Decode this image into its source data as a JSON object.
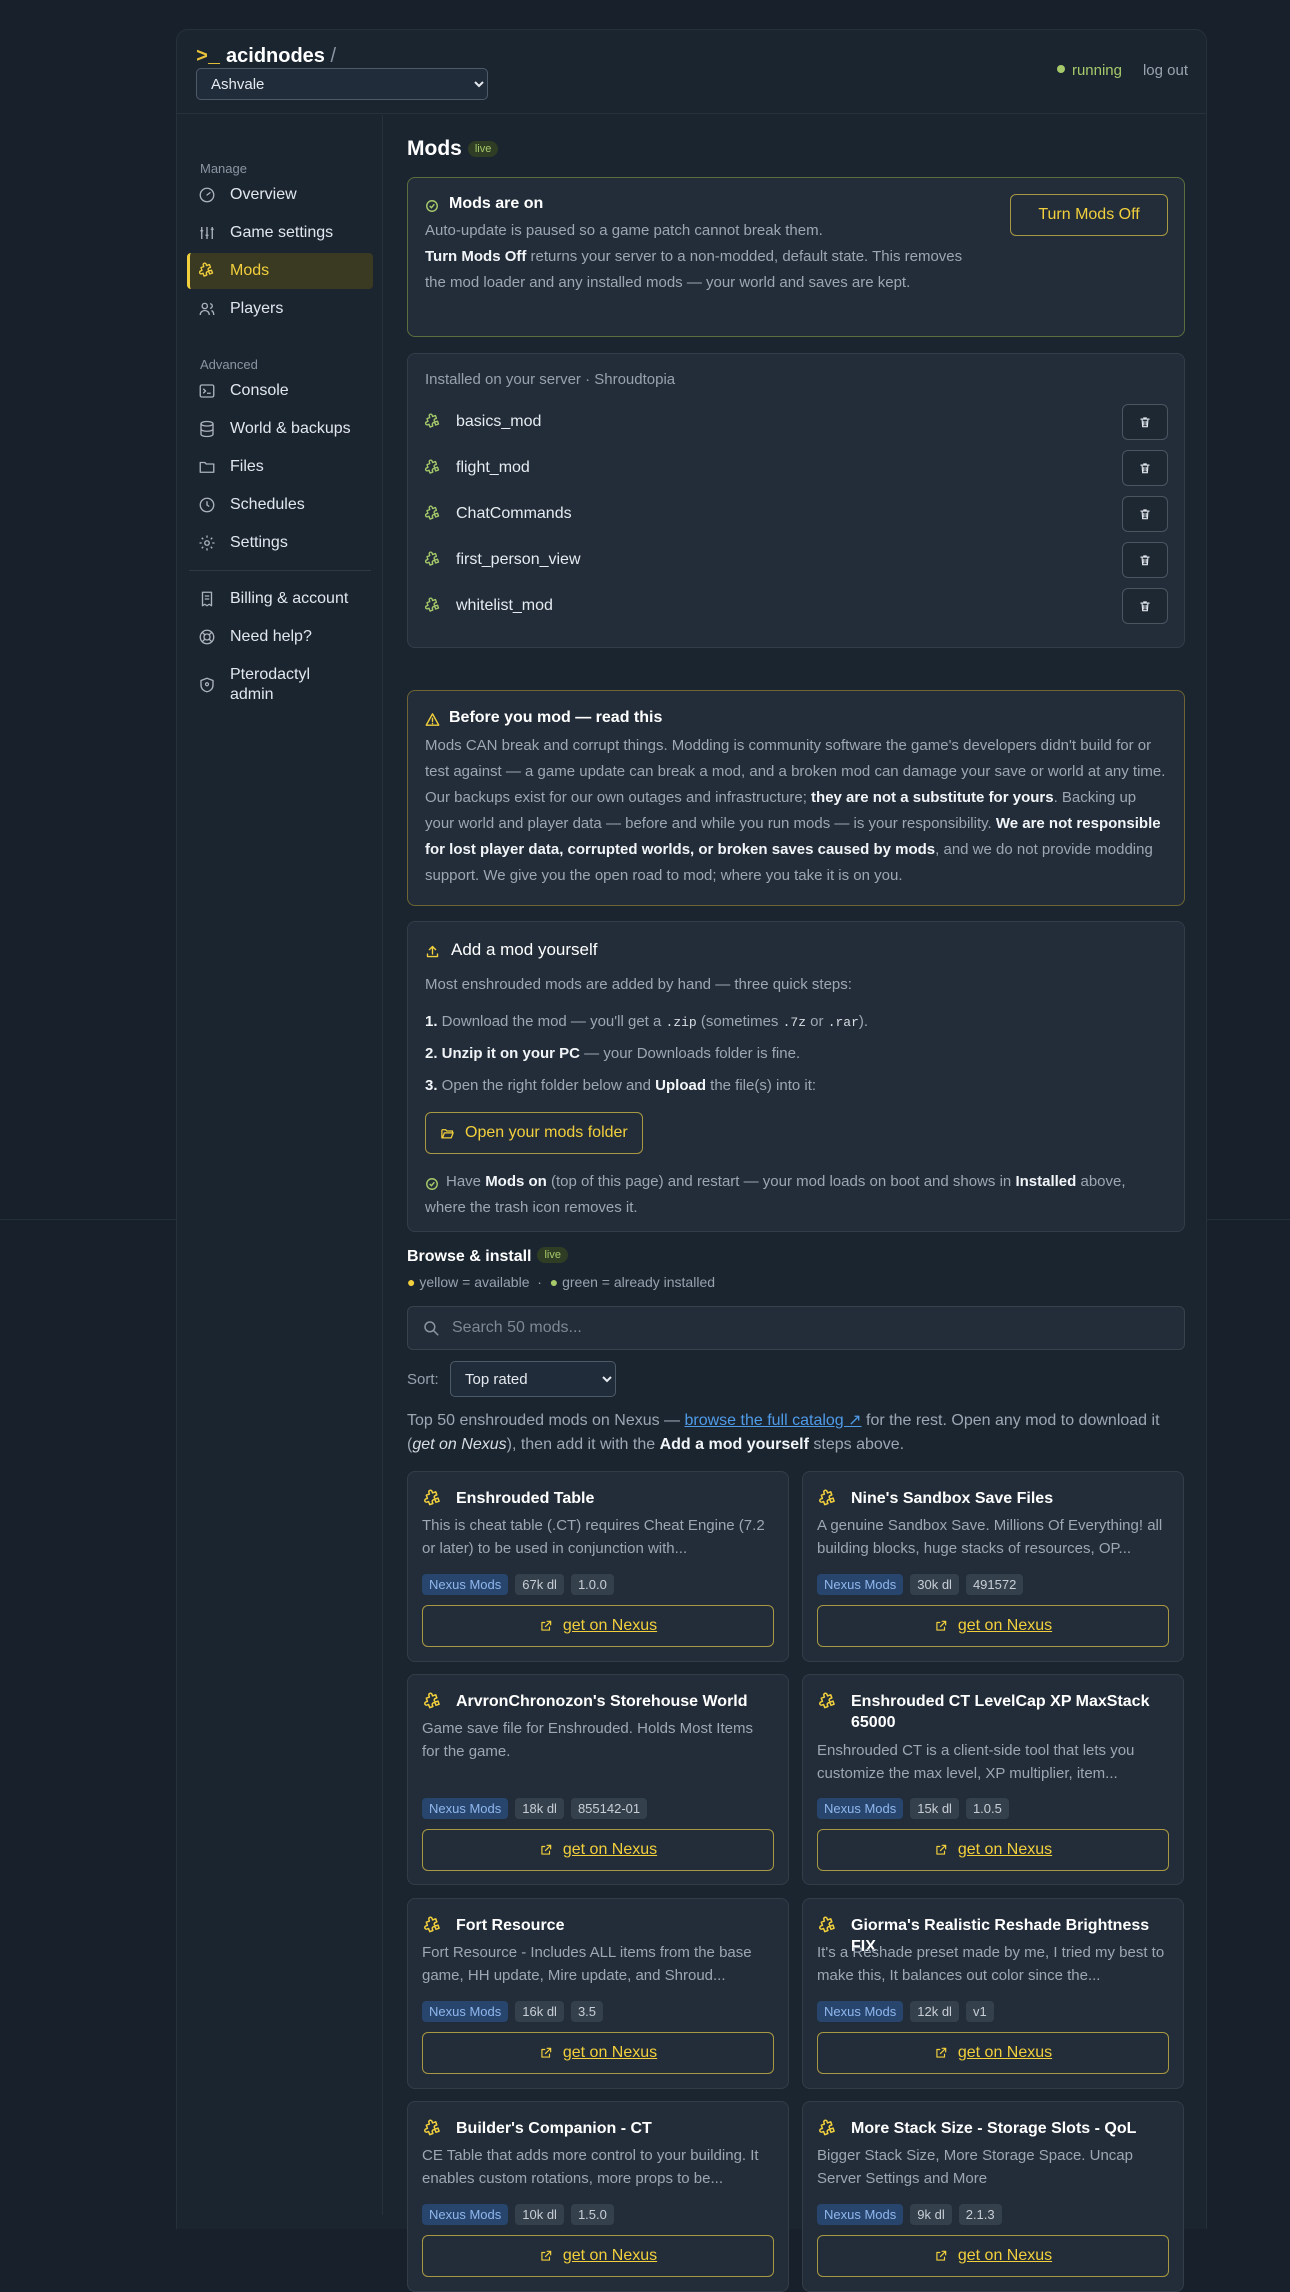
{
  "header": {
    "prompt": ">_",
    "brand": "acidnodes",
    "slash": "/",
    "server_selected": "Ashvale",
    "status": "running",
    "logout": "log out"
  },
  "sidebar": {
    "manage_label": "Manage",
    "advanced_label": "Advanced",
    "items": [
      {
        "label": "Overview",
        "icon": "gauge-icon"
      },
      {
        "label": "Game settings",
        "icon": "sliders-icon"
      },
      {
        "label": "Mods",
        "icon": "puzzle-icon",
        "active": true
      },
      {
        "label": "Players",
        "icon": "users-icon"
      },
      {
        "label": "Console",
        "icon": "terminal-icon"
      },
      {
        "label": "World & backups",
        "icon": "database-icon"
      },
      {
        "label": "Files",
        "icon": "folder-icon"
      },
      {
        "label": "Schedules",
        "icon": "clock-icon"
      },
      {
        "label": "Settings",
        "icon": "gear-icon"
      },
      {
        "label": "Billing & account",
        "icon": "receipt-icon"
      },
      {
        "label": "Need help?",
        "icon": "lifebuoy-icon"
      },
      {
        "label": "Pterodactyl admin",
        "icon": "shield-icon"
      }
    ]
  },
  "mods_page": {
    "title": "Mods",
    "live_badge": "live",
    "status_card": {
      "heading": "Mods are on",
      "line1": "Auto-update is paused so a game patch cannot break them.",
      "line2_bold": "Turn Mods Off",
      "line2_rest": " returns your server to a non-modded, default state. This removes the mod loader and any installed mods — your world and saves are kept.",
      "button": "Turn Mods Off"
    },
    "installed": {
      "heading": "Installed on your server · Shroudtopia",
      "mods": [
        "basics_mod",
        "flight_mod",
        "ChatCommands",
        "first_person_view",
        "whitelist_mod"
      ]
    },
    "warning": {
      "heading": "Before you mod — read this",
      "p1": "Mods CAN break and corrupt things. Modding is community software the game's developers didn't build for or test against — a game update can break a mod, and a broken mod can damage your save or world at any time. Our backups exist for our own outages and infrastructure; ",
      "p1_bold": "they are not a substitute for yours",
      "p2": ". Backing up your world and player data — before and while you run mods — is your responsibility. ",
      "p2_bold": "We are not responsible for lost player data, corrupted worlds, or broken saves caused by mods",
      "p3": ", and we do not provide modding support. We give you the open road to mod; where you take it is on you."
    },
    "add_mod": {
      "heading": "Add a mod yourself",
      "intro": "Most enshrouded mods are added by hand — three quick steps:",
      "s1_num": "1.",
      "s1_a": " Download the mod — you'll get a ",
      "s1_code1": ".zip",
      "s1_b": " (sometimes ",
      "s1_code2": ".7z",
      "s1_c": " or ",
      "s1_code3": ".rar",
      "s1_d": ").",
      "s2_num": "2.",
      "s2_bold": " Unzip it on your PC",
      "s2_rest": " — your Downloads folder is fine.",
      "s3_num": "3.",
      "s3_a": " Open the right folder below and ",
      "s3_bold": "Upload",
      "s3_b": " the file(s) into it:",
      "button": "Open your mods folder",
      "note_a": "Have ",
      "note_bold1": "Mods on",
      "note_b": " (top of this page) and restart — your mod loads on boot and shows in ",
      "note_bold2": "Installed",
      "note_c": " above, where the trash icon removes it."
    },
    "browse": {
      "heading": "Browse & install",
      "live_badge": "live",
      "legend_yellow": "yellow = available",
      "legend_sep": "·",
      "legend_green": "green = already installed",
      "search_placeholder": "Search 50 mods...",
      "sort_label": "Sort:",
      "sort_selected": "Top rated",
      "info_a": "Top 50 enshrouded mods on Nexus — ",
      "info_link": "browse the full catalog ↗",
      "info_b": " for the rest. Open any mod to download it (",
      "info_italic": "get on Nexus",
      "info_c": "), then add it with the ",
      "info_bold": "Add a mod yourself",
      "info_d": " steps above.",
      "get_label": "get on Nexus",
      "colors": {
        "available": "#f2cf3c",
        "installed": "#a6c96a"
      },
      "cards": [
        {
          "title": "Enshrouded Table",
          "desc": "This is cheat table (.CT) requires Cheat Engine (7.2 or later) to be used in conjunction with...",
          "source": "Nexus Mods",
          "downloads": "67k dl",
          "version": "1.0.0"
        },
        {
          "title": "Nine's Sandbox Save Files",
          "desc": "A genuine Sandbox Save. Millions Of Everything! all building blocks, huge stacks of resources, OP...",
          "source": "Nexus Mods",
          "downloads": "30k dl",
          "version": "491572"
        },
        {
          "title": "ArvronChronozon's Storehouse World",
          "desc": "Game save file for Enshrouded. Holds Most Items for the game.",
          "source": "Nexus Mods",
          "downloads": "18k dl",
          "version": "855142-01"
        },
        {
          "title": "Enshrouded CT LevelCap XP MaxStack 65000",
          "desc": "Enshrouded CT is a client-side tool that lets you customize the max level, XP multiplier, item...",
          "source": "Nexus Mods",
          "downloads": "15k dl",
          "version": "1.0.5"
        },
        {
          "title": "Fort Resource",
          "desc": "Fort Resource - Includes ALL items from the base game, HH update, Mire update, and Shroud...",
          "source": "Nexus Mods",
          "downloads": "16k dl",
          "version": "3.5"
        },
        {
          "title": "Giorma's Realistic Reshade Brightness FIX",
          "desc": "It's a Reshade preset made by me, I tried my best to make this, It balances out color since the...",
          "source": "Nexus Mods",
          "downloads": "12k dl",
          "version": "v1"
        },
        {
          "title": "Builder's Companion - CT",
          "desc": "CE Table that adds more control to your building. It enables custom rotations, more props to be...",
          "source": "Nexus Mods",
          "downloads": "10k dl",
          "version": "1.5.0"
        },
        {
          "title": "More Stack Size - Storage Slots - QoL",
          "desc": "Bigger Stack Size, More Storage Space. Uncap Server Settings and More",
          "source": "Nexus Mods",
          "downloads": "9k dl",
          "version": "2.1.3"
        }
      ]
    }
  }
}
